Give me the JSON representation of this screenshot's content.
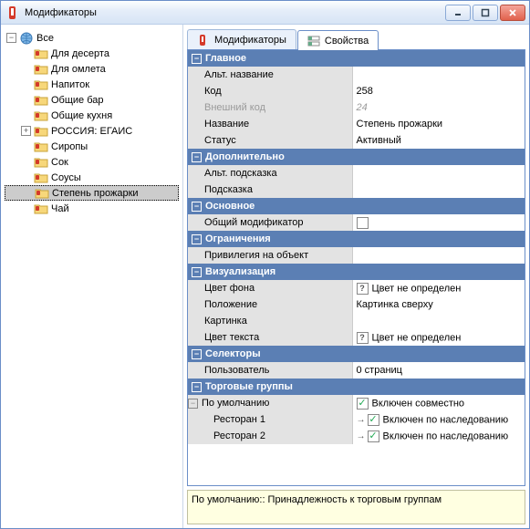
{
  "window": {
    "title": "Модификаторы"
  },
  "tree": {
    "root": {
      "label": "Все"
    },
    "items": [
      {
        "label": "Для десерта"
      },
      {
        "label": "Для омлета"
      },
      {
        "label": "Напиток"
      },
      {
        "label": "Общие бар"
      },
      {
        "label": "Общие кухня"
      },
      {
        "label": "РОССИЯ: ЕГАИС",
        "expandable": true
      },
      {
        "label": "Сиропы"
      },
      {
        "label": "Сок"
      },
      {
        "label": "Соусы"
      },
      {
        "label": "Степень прожарки",
        "selected": true
      },
      {
        "label": "Чай"
      }
    ]
  },
  "tabs": {
    "modifiers": "Модификаторы",
    "properties": "Свойства"
  },
  "groups": {
    "main": {
      "title": "Главное",
      "alt_name": {
        "label": "Альт. название",
        "value": ""
      },
      "code": {
        "label": "Код",
        "value": "258"
      },
      "ext_code": {
        "label": "Внешний код",
        "value": "24"
      },
      "name": {
        "label": "Название",
        "value": "Степень прожарки"
      },
      "status": {
        "label": "Статус",
        "value": "Активный"
      }
    },
    "extra": {
      "title": "Дополнительно",
      "alt_hint": {
        "label": "Альт. подсказка",
        "value": ""
      },
      "hint": {
        "label": "Подсказка",
        "value": ""
      }
    },
    "basic": {
      "title": "Основное",
      "common_mod": {
        "label": "Общий модификатор",
        "checked": false
      }
    },
    "restrict": {
      "title": "Ограничения",
      "priv": {
        "label": "Привилегия на объект",
        "value": ""
      }
    },
    "visual": {
      "title": "Визуализация",
      "bg": {
        "label": "Цвет фона",
        "value": "Цвет не определен"
      },
      "pos": {
        "label": "Положение",
        "value": "Картинка сверху"
      },
      "pic": {
        "label": "Картинка",
        "value": ""
      },
      "fg": {
        "label": "Цвет текста",
        "value": "Цвет не определен"
      }
    },
    "selectors": {
      "title": "Селекторы",
      "user": {
        "label": "Пользователь",
        "value": "0 страниц"
      }
    },
    "trade": {
      "title": "Торговые группы",
      "default": {
        "label": "По умолчанию",
        "value": "Включен совместно"
      },
      "r1": {
        "label": "Ресторан 1",
        "value": "Включен по наследованию"
      },
      "r2": {
        "label": "Ресторан 2",
        "value": "Включен по наследованию"
      }
    }
  },
  "status": "По умолчанию:: Принадлежность к торговым группам"
}
